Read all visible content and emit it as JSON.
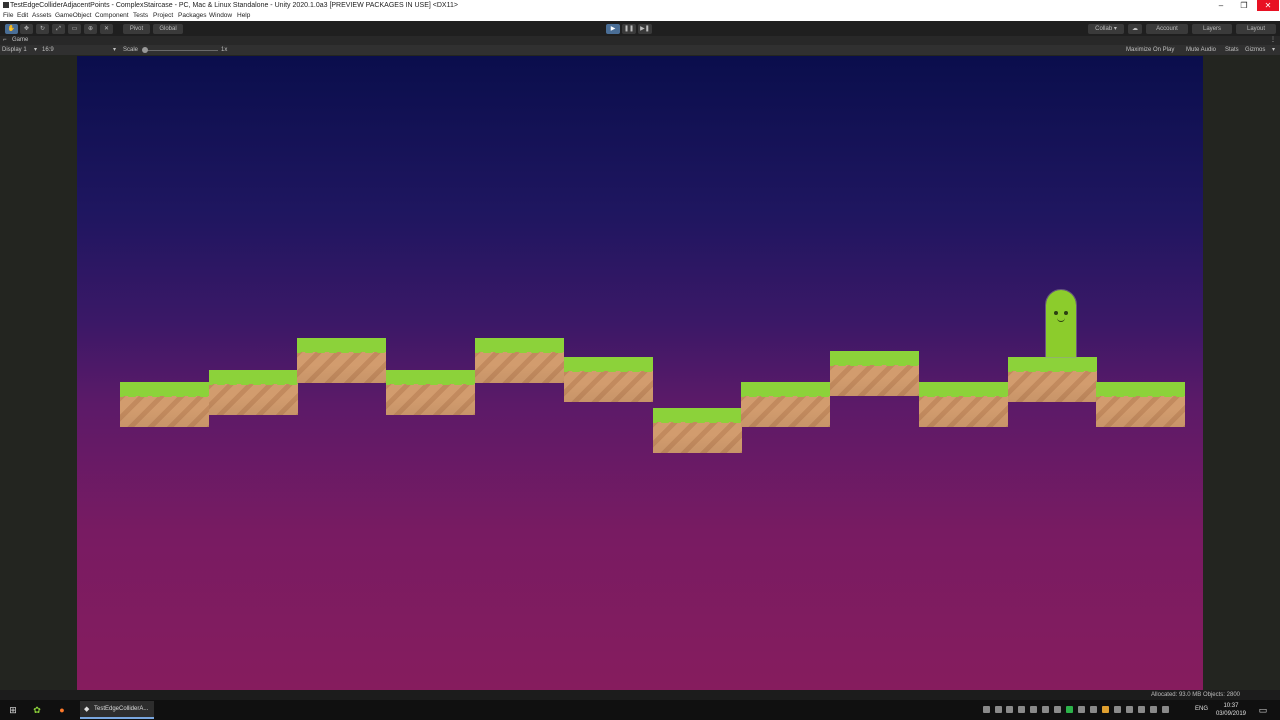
{
  "window": {
    "title": "TestEdgeColliderAdjacentPoints - ComplexStaircase - PC, Mac & Linux Standalone - Unity 2020.1.0a3 [PREVIEW PACKAGES IN USE] <DX11>",
    "minimize": "–",
    "maximize": "❐",
    "close": "✕"
  },
  "menu": [
    "File",
    "Edit",
    "Assets",
    "GameObject",
    "Component",
    "Tests",
    "Project",
    "Packages",
    "Window",
    "Help"
  ],
  "toolbar": {
    "pivot": "Pivot",
    "global": "Global",
    "play": "▶",
    "pause": "❚❚",
    "step": "▶❚",
    "collab": "Collab ▾",
    "cloud": "☁",
    "account": "Account",
    "layers": "Layers",
    "layout": "Layout"
  },
  "tab": {
    "label": "Game",
    "menu": "⋮"
  },
  "gamebar": {
    "display": "Display 1",
    "aspect": "16:9",
    "scale_label": "Scale",
    "scale_value": "1x",
    "maximize": "Maximize On Play",
    "mute": "Mute Audio",
    "stats": "Stats",
    "gizmos": "Gizmos"
  },
  "status": {
    "allocated": "Allocated: 93.0 MB Objects: 2800"
  },
  "taskbar": {
    "app_label": "TestEdgeColliderA...",
    "lang": "ENG",
    "time": "10:37",
    "date": "03/09/2019"
  },
  "colors": {
    "grass": "#8cd23a",
    "dirt": "#d29c6e",
    "player": "#8ccc2c",
    "sky_top": "#0a0e4c",
    "sky_bottom": "#861c5e",
    "play_active": "#4a6e96"
  }
}
